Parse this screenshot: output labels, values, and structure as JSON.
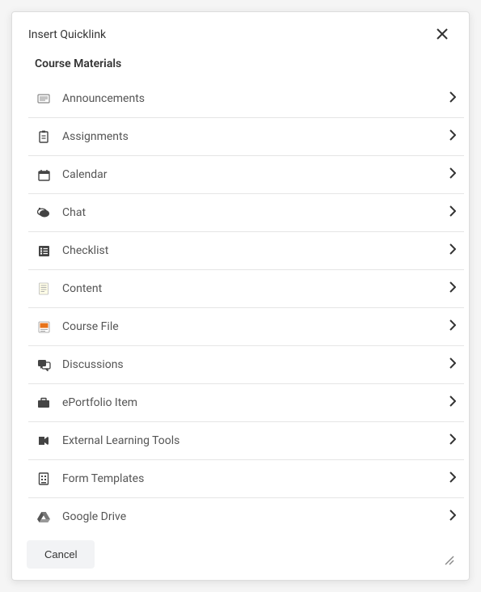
{
  "modal": {
    "title": "Insert Quicklink",
    "section_title": "Course Materials",
    "cancel_label": "Cancel",
    "items": [
      {
        "label": "Announcements",
        "icon": "announcements-icon"
      },
      {
        "label": "Assignments",
        "icon": "assignments-icon"
      },
      {
        "label": "Calendar",
        "icon": "calendar-icon"
      },
      {
        "label": "Chat",
        "icon": "chat-icon"
      },
      {
        "label": "Checklist",
        "icon": "checklist-icon"
      },
      {
        "label": "Content",
        "icon": "content-icon"
      },
      {
        "label": "Course File",
        "icon": "course-file-icon"
      },
      {
        "label": "Discussions",
        "icon": "discussions-icon"
      },
      {
        "label": "ePortfolio Item",
        "icon": "eportfolio-icon"
      },
      {
        "label": "External Learning Tools",
        "icon": "external-tools-icon"
      },
      {
        "label": "Form Templates",
        "icon": "form-templates-icon"
      },
      {
        "label": "Google Drive",
        "icon": "google-drive-icon"
      }
    ]
  }
}
